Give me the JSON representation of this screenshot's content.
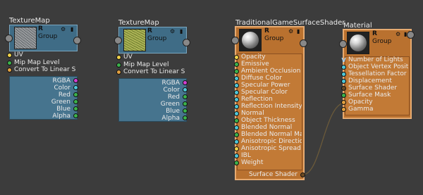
{
  "nodes": {
    "tex1": {
      "title": "TextureMap",
      "header": {
        "r": "R",
        "group": "Group",
        "gear": "⚙",
        "lock": "▮"
      },
      "inputs": [
        "UV",
        "Mip Map Level",
        "Convert To Linear S"
      ],
      "outputs": [
        "RGBA",
        "Color",
        "Red",
        "Green",
        "Blue",
        "Alpha"
      ]
    },
    "tex2": {
      "title": "TextureMap",
      "header": {
        "r": "R",
        "group": "Group",
        "gear": "⚙",
        "lock": "▮"
      },
      "inputs": [
        "UV",
        "Mip Map Level",
        "Convert To Linear S"
      ],
      "outputs": [
        "RGBA",
        "Color",
        "Red",
        "Green",
        "Blue",
        "Alpha"
      ]
    },
    "shader": {
      "title": "TraditionalGameSurfaceShader",
      "header": {
        "r": "R",
        "group": "Group",
        "gear": "⚙",
        "lock": "▮"
      },
      "inputs": [
        "Opacity",
        "Emissive",
        "Ambient Occlusion",
        "Diffuse Color",
        "Specular Power",
        "Specular Color",
        "Reflection",
        "Reflection Intensity",
        "Normal",
        "Object Thickness",
        "Blended Normal",
        "Blended Normal Ma",
        "Anisotropic Directio",
        "Anisotropic Spread",
        "IBL",
        "Weight"
      ],
      "output": "Surface Shader"
    },
    "material": {
      "title": "Material",
      "header": {
        "r": "R",
        "group": "Group",
        "gear": "⚙",
        "lock": "▮"
      },
      "inputs": [
        "Number of Lights",
        "Object Vertex Posit",
        "Tessellation Factor",
        "Displacement",
        "Surface Shader",
        "Surface Mask",
        "Opacity",
        "Gamma"
      ]
    }
  },
  "colors": {
    "texture_node": "#3f6c86",
    "shader_node": "#b9712f",
    "canvas": "#3c3c3c"
  }
}
